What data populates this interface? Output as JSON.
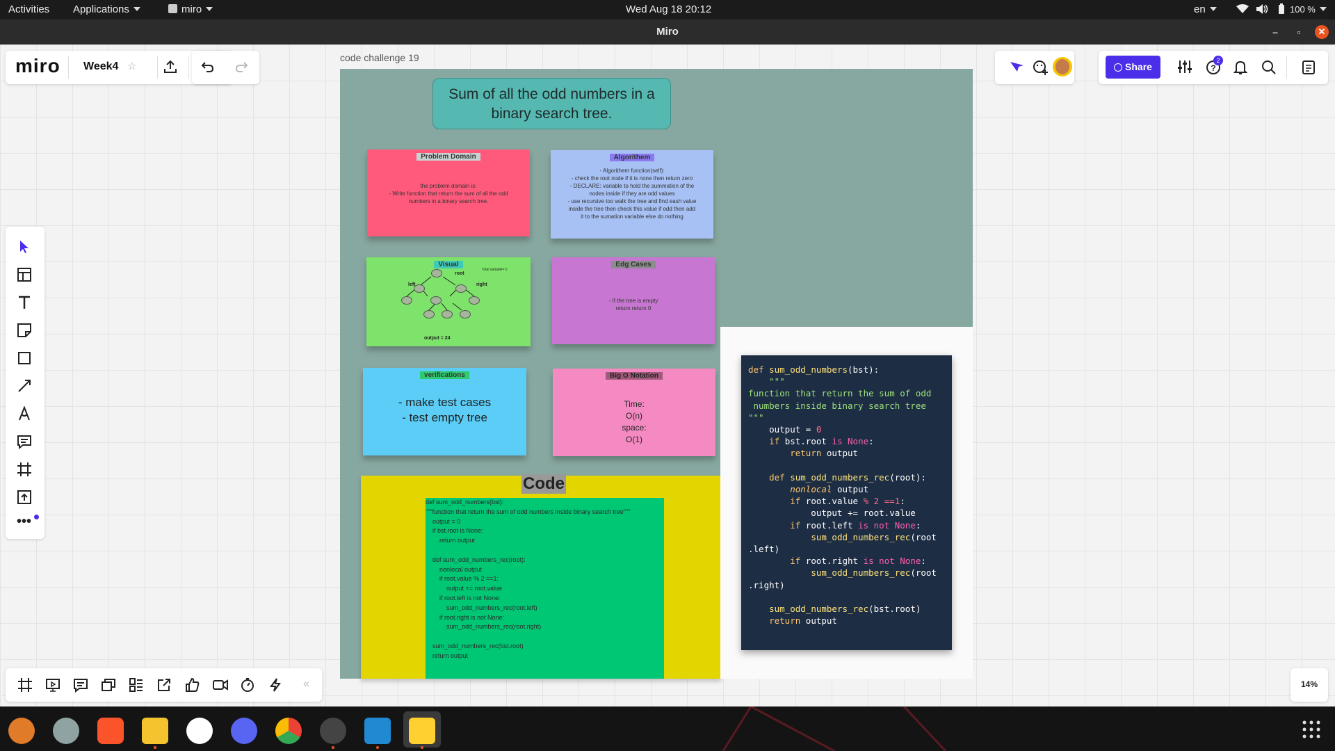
{
  "topbar": {
    "activities": "Activities",
    "applications": "Applications",
    "app_name": "miro",
    "datetime": "Wed Aug 18  20:12",
    "language": "en",
    "battery": "100 %"
  },
  "window": {
    "title": "Miro"
  },
  "miro": {
    "logo": "miro",
    "board_name": "Week4",
    "share_label": "Share",
    "notification_badge": "2",
    "zoom": "14%"
  },
  "board": {
    "frame_title": "code challenge 19",
    "title": "Sum of all the odd numbers in a binary search tree.",
    "problem_domain": {
      "heading": "Problem Domain",
      "lines": [
        "the problem domain is:",
        "- Write function that return the  sum of all the odd",
        "numbers in a binary search tree."
      ]
    },
    "algorithm": {
      "heading": "Algorithem",
      "lines": [
        "- Algorithem function(self):",
        "- check the root node if it is none then return zero",
        "- DECLARE: variable to hold the summation of the",
        "nodes inside if they are odd values",
        "- use recursive too walk the tree and find eash value",
        "inside the tree then check this value if odd then add",
        "it to the sumation variable else do nothing"
      ]
    },
    "visual": {
      "heading": "Visual",
      "total_label": "Total variable= 0",
      "root_label": "root",
      "left_label": "left",
      "right_label": "right",
      "output": "output = 24"
    },
    "edge_cases": {
      "heading": "Edg Cases",
      "lines": [
        "- If the tree is empty",
        "return return 0"
      ]
    },
    "verifications": {
      "heading": "verifications",
      "lines": [
        "- make test cases",
        "- test empty tree"
      ]
    },
    "big_o": {
      "heading": "Big O Notation",
      "lines": [
        "Time:",
        "O(n)",
        "space:",
        "O(1)"
      ]
    },
    "code_section": {
      "heading": "Code",
      "text": "def sum_odd_numbers(bst):\n\"\"\"function that return the sum of odd numbers inside binary search tree\"\"\"\n    output = 0\n    if bst.root is None:\n        return output\n\n    def sum_odd_numbers_rec(root):\n        nonlocal output\n        if root.value % 2 ==1:\n            output += root.value\n        if root.left is not None:\n            sum_odd_numbers_rec(root.left)\n        if root.right is not None:\n            sum_odd_numbers_rec(root.right)\n\n    sum_odd_numbers_rec(bst.root)\n    return output"
    }
  },
  "colors": {
    "accent": "#4a2eea",
    "frame": "#87a8a0",
    "problem": "#ff5a7c",
    "algorithm": "#a7c1f5",
    "visual": "#7ee36a",
    "edge": "#c776d1",
    "verify": "#5bcdf7",
    "bigo": "#f58ac3",
    "code_yellow": "#e3d500",
    "code_green": "#00c774"
  }
}
